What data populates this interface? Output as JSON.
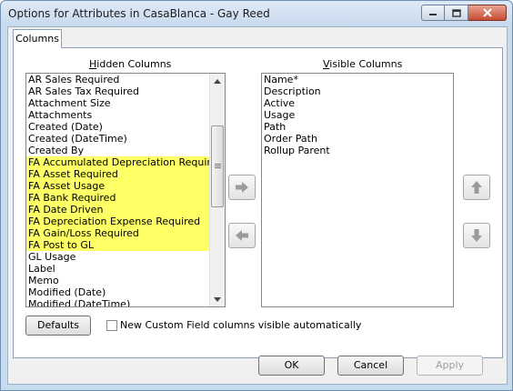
{
  "window": {
    "title": "Options for Attributes in CasaBlanca - Gay Reed"
  },
  "tabs": [
    {
      "label": "Columns"
    }
  ],
  "hidden_columns": {
    "label": "Hidden Columns",
    "items": [
      {
        "label": "AR Sales Required",
        "highlighted": false
      },
      {
        "label": "AR Sales Tax Required",
        "highlighted": false
      },
      {
        "label": "Attachment Size",
        "highlighted": false
      },
      {
        "label": "Attachments",
        "highlighted": false
      },
      {
        "label": "Created (Date)",
        "highlighted": false
      },
      {
        "label": "Created (DateTime)",
        "highlighted": false
      },
      {
        "label": "Created By",
        "highlighted": false
      },
      {
        "label": "FA Accumulated Depreciation Required",
        "highlighted": true
      },
      {
        "label": "FA Asset Required",
        "highlighted": true
      },
      {
        "label": "FA Asset Usage",
        "highlighted": true
      },
      {
        "label": "FA Bank Required",
        "highlighted": true
      },
      {
        "label": "FA Date Driven",
        "highlighted": true
      },
      {
        "label": "FA Depreciation Expense Required",
        "highlighted": true
      },
      {
        "label": "FA Gain/Loss Required",
        "highlighted": true
      },
      {
        "label": "FA Post to GL",
        "highlighted": true
      },
      {
        "label": "GL Usage",
        "highlighted": false
      },
      {
        "label": "Label",
        "highlighted": false
      },
      {
        "label": "Memo",
        "highlighted": false
      },
      {
        "label": "Modified (Date)",
        "highlighted": false
      },
      {
        "label": "Modified (DateTime)",
        "highlighted": false
      }
    ]
  },
  "visible_columns": {
    "label": "Visible Columns",
    "items": [
      "Name*",
      "Description",
      "Active",
      "Usage",
      "Path",
      "Order Path",
      "Rollup Parent"
    ]
  },
  "highlight_color": "#ffff66",
  "defaults_button": "Defaults",
  "auto_visible_checkbox": {
    "label": "New Custom Field columns visible automatically",
    "checked": false
  },
  "footer": {
    "ok": "OK",
    "cancel": "Cancel",
    "apply": "Apply"
  }
}
